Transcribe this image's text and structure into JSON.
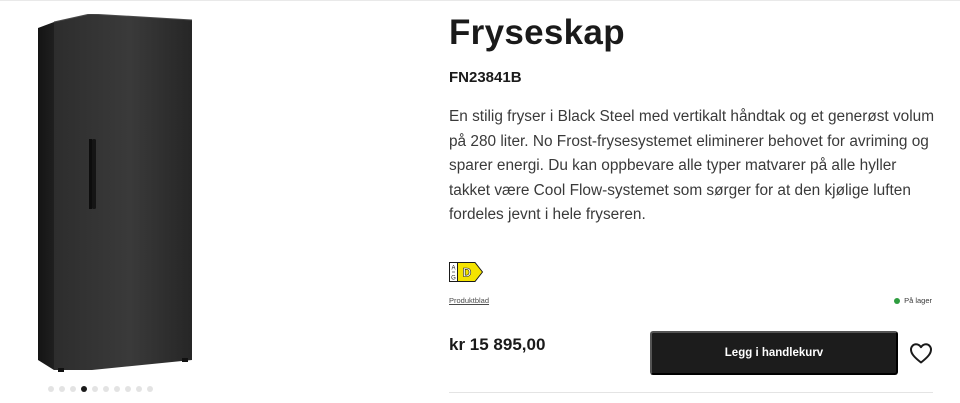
{
  "product": {
    "title": "Fryseskap",
    "model": "FN23841B",
    "description": "En stilig fryser i Black Steel med vertikalt håndtak og et generøst volum på 280 liter. No Frost-frysesystemet eliminerer behovet for avriming og sparer energi. Du kan oppbevare alle typer matvarer på alle hyller takket være Cool Flow-systemet som sørger for at den kjølige luften fordeles jevnt i hele fryseren.",
    "energy_class": "D",
    "energy_scale_top": "A",
    "energy_scale_bottom": "G",
    "datasheet_label": "Produktblad",
    "stock_label": "På lager",
    "price": "kr 15 895,00",
    "cart_label": "Legg i handlekurv"
  },
  "gallery": {
    "dot_count": 10,
    "active_index": 3
  },
  "colors": {
    "energy_badge": "#f4e300",
    "stock_indicator": "#2e9d3f",
    "button_bg": "#1c1c1c",
    "appliance": "#2b2b2b"
  },
  "icons": {
    "wishlist": "heart-outline-icon"
  }
}
